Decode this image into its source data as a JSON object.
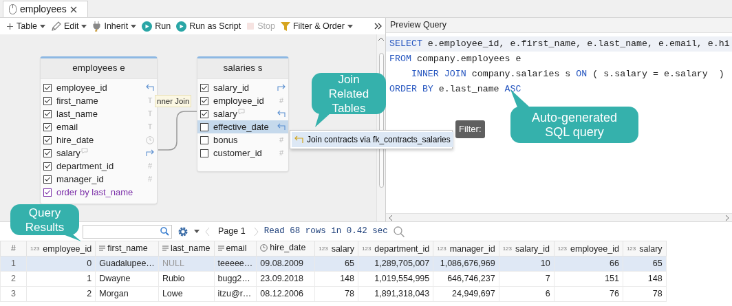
{
  "tabs": [
    {
      "label": "employees",
      "selected": true
    }
  ],
  "toolbar": [
    {
      "label": "Table",
      "dropdown": true,
      "disabled": false
    },
    {
      "label": "Edit",
      "dropdown": true,
      "disabled": false
    },
    {
      "label": "Inherit",
      "dropdown": true,
      "disabled": false
    },
    {
      "label": "Run",
      "dropdown": false,
      "disabled": false
    },
    {
      "label": "Run as Script",
      "dropdown": false,
      "disabled": false
    },
    {
      "label": "Stop",
      "dropdown": false,
      "disabled": true
    },
    {
      "label": "Filter & Order",
      "dropdown": true,
      "disabled": false
    }
  ],
  "canvas": {
    "tables": [
      {
        "title": "employees e",
        "columns": [
          {
            "name": "employee_id",
            "checked": true,
            "selected": false,
            "kind": "key_in"
          },
          {
            "name": "first_name",
            "checked": true,
            "selected": false,
            "kind": "text",
            "type_mark": "T"
          },
          {
            "name": "last_name",
            "checked": true,
            "selected": false,
            "kind": "text",
            "type_mark": "T"
          },
          {
            "name": "email",
            "checked": true,
            "selected": false,
            "kind": "text",
            "type_mark": "T"
          },
          {
            "name": "hire_date",
            "checked": true,
            "selected": false,
            "kind": "date"
          },
          {
            "name": "salary",
            "checked": true,
            "selected": false,
            "kind": "key_out",
            "comment": true
          },
          {
            "name": "department_id",
            "checked": true,
            "selected": false,
            "kind": "number",
            "type_mark": "#"
          },
          {
            "name": "manager_id",
            "checked": true,
            "selected": false,
            "kind": "number",
            "type_mark": "#"
          },
          {
            "name": "order by last_name",
            "checked": true,
            "selected": false,
            "kind": "order"
          }
        ]
      },
      {
        "title": "salaries s",
        "columns": [
          {
            "name": "salary_id",
            "checked": true,
            "selected": false,
            "kind": "key_out"
          },
          {
            "name": "employee_id",
            "checked": true,
            "selected": false,
            "kind": "number",
            "type_mark": "#"
          },
          {
            "name": "salary",
            "checked": true,
            "selected": false,
            "kind": "key_in",
            "comment": true
          },
          {
            "name": "effective_date",
            "checked": false,
            "selected": true,
            "kind": "key_in"
          },
          {
            "name": "bonus",
            "checked": false,
            "selected": false,
            "kind": "number",
            "type_mark": "#"
          },
          {
            "name": "customer_id",
            "checked": false,
            "selected": false,
            "kind": "number",
            "type_mark": "#"
          }
        ]
      }
    ],
    "join_label": "nner Join",
    "join_menu": [
      {
        "label": "Join contracts via fk_contracts_salaries"
      }
    ],
    "tooltip": "Filter:"
  },
  "preview": {
    "title": "Preview Query",
    "lines": [
      {
        "current": true,
        "tokens": [
          {
            "text": "SELECT",
            "kind": "keyword"
          },
          {
            "text": " e.employee_id, e.first_name, e.last_name, e.email, e.hi",
            "kind": "plain"
          }
        ]
      },
      {
        "current": false,
        "tokens": [
          {
            "text": "FROM",
            "kind": "keyword"
          },
          {
            "text": " company.employees e",
            "kind": "plain"
          }
        ]
      },
      {
        "current": false,
        "tokens": [
          {
            "text": "    INNER JOIN",
            "kind": "keyword"
          },
          {
            "text": " company.salaries s ",
            "kind": "plain"
          },
          {
            "text": "ON",
            "kind": "keyword"
          },
          {
            "text": " ( s.salary = e.salary  )",
            "kind": "plain"
          }
        ]
      },
      {
        "current": false,
        "tokens": [
          {
            "text": "ORDER BY",
            "kind": "keyword"
          },
          {
            "text": " e.last_name ",
            "kind": "plain"
          },
          {
            "text": "ASC",
            "kind": "keyword"
          }
        ]
      }
    ]
  },
  "results": {
    "page": "Page 1",
    "status": "Read 68 rows in 0.42 sec",
    "columns": [
      {
        "label": "#",
        "kind": "index"
      },
      {
        "label": "employee_id",
        "kind": "number",
        "type_mark": "123"
      },
      {
        "label": "first_name",
        "kind": "text"
      },
      {
        "label": "last_name",
        "kind": "text"
      },
      {
        "label": "email",
        "kind": "text"
      },
      {
        "label": "hire_date",
        "kind": "date"
      },
      {
        "label": "salary",
        "kind": "number",
        "type_mark": "123"
      },
      {
        "label": "department_id",
        "kind": "number",
        "type_mark": "123"
      },
      {
        "label": "manager_id",
        "kind": "number",
        "type_mark": "123"
      },
      {
        "label": "salary_id",
        "kind": "number",
        "type_mark": "123"
      },
      {
        "label": "employee_id",
        "kind": "number",
        "type_mark": "123"
      },
      {
        "label": "salary",
        "kind": "number",
        "type_mark": "123"
      }
    ],
    "rows": [
      {
        "selected": true,
        "cells": [
          "1",
          "0",
          "Guadalupee…",
          {
            "text": "NULL",
            "kind": "null"
          },
          "teeeee…",
          "09.08.2009",
          "65",
          "1,289,705,007",
          "1,086,676,969",
          "10",
          "66",
          "65"
        ]
      },
      {
        "selected": false,
        "cells": [
          "2",
          "1",
          "Dwayne",
          "Rubio",
          "bugg2…",
          "23.09.2018",
          "148",
          "1,019,554,995",
          "646,746,237",
          "7",
          "151",
          "148"
        ]
      },
      {
        "selected": false,
        "cells": [
          "3",
          "2",
          "Morgan",
          "Lowe",
          "itzu@r…",
          "08.12.2006",
          "78",
          "1,891,318,043",
          "24,949,697",
          "6",
          "76",
          "78"
        ]
      }
    ]
  },
  "callouts": [
    {
      "text": "Query Results"
    },
    {
      "text": "Join Related Tables"
    },
    {
      "text": "Auto-generated SQL query"
    }
  ]
}
